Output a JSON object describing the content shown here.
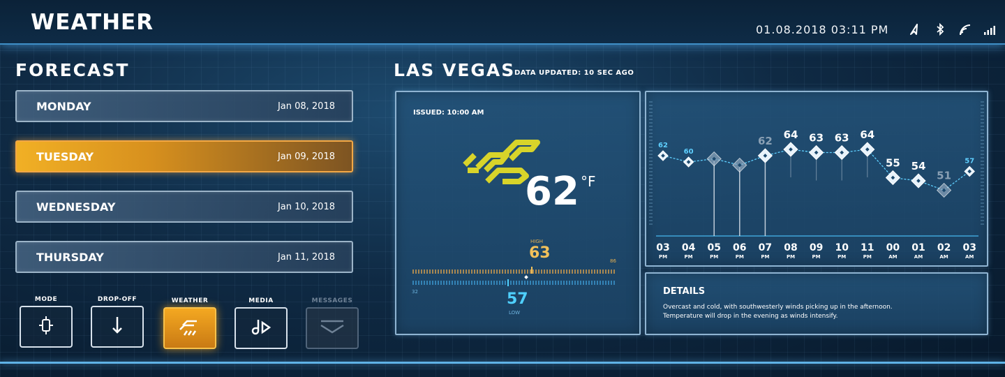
{
  "header": {
    "title": "WEATHER",
    "datetime": "01.08.2018   03:11 PM",
    "status_icons": [
      "navigation-icon",
      "bluetooth-icon",
      "wifi-icon",
      "signal-icon"
    ]
  },
  "forecast": {
    "title": "FORECAST",
    "days": [
      {
        "name": "MONDAY",
        "date": "Jan 08, 2018",
        "active": false
      },
      {
        "name": "TUESDAY",
        "date": "Jan 09, 2018",
        "active": true
      },
      {
        "name": "WEDNESDAY",
        "date": "Jan 10, 2018",
        "active": false
      },
      {
        "name": "THURSDAY",
        "date": "Jan 11, 2018",
        "active": false
      }
    ]
  },
  "nav": {
    "items": [
      {
        "label": "MODE",
        "icon": "mode-chip-icon",
        "state": "normal"
      },
      {
        "label": "DROP-OFF",
        "icon": "drop-off-arrow-icon",
        "state": "normal"
      },
      {
        "label": "WEATHER",
        "icon": "weather-rain-icon",
        "state": "active"
      },
      {
        "label": "MEDIA",
        "icon": "media-play-icon",
        "state": "normal"
      },
      {
        "label": "MESSAGES",
        "icon": "messages-icon",
        "state": "disabled"
      }
    ]
  },
  "location": {
    "city": "LAS VEGAS",
    "updated": "DATA UPDATED: 10 SEC AGO"
  },
  "current": {
    "issued": "ISSUED: 10:00 AM",
    "temp": "62",
    "unit": "°F",
    "icon": "cloud-weather-icon",
    "high_label": "HIGH",
    "high": "63",
    "low_label": "LOW",
    "low": "57",
    "scale_min": "32",
    "scale_max": "86"
  },
  "hourly": {
    "points": [
      {
        "hour": "03",
        "ampm": "PM",
        "temp": "62"
      },
      {
        "hour": "04",
        "ampm": "PM",
        "temp": "60"
      },
      {
        "hour": "05",
        "ampm": "PM",
        "temp": ""
      },
      {
        "hour": "06",
        "ampm": "PM",
        "temp": ""
      },
      {
        "hour": "07",
        "ampm": "PM",
        "temp": "62"
      },
      {
        "hour": "08",
        "ampm": "PM",
        "temp": "64"
      },
      {
        "hour": "09",
        "ampm": "PM",
        "temp": "63"
      },
      {
        "hour": "10",
        "ampm": "PM",
        "temp": "63"
      },
      {
        "hour": "11",
        "ampm": "PM",
        "temp": "64"
      },
      {
        "hour": "00",
        "ampm": "AM",
        "temp": "55"
      },
      {
        "hour": "01",
        "ampm": "AM",
        "temp": "54"
      },
      {
        "hour": "02",
        "ampm": "AM",
        "temp": "51"
      },
      {
        "hour": "03",
        "ampm": "AM",
        "temp": "57"
      }
    ],
    "values": [
      62,
      60,
      61,
      59,
      62,
      64,
      63,
      63,
      64,
      55,
      54,
      51,
      57
    ]
  },
  "details": {
    "title": "DETAILS",
    "text": "Overcast and cold, with southwesterly winds picking up in the afternoon. Temperature will drop in the evening as winds intensify."
  }
}
